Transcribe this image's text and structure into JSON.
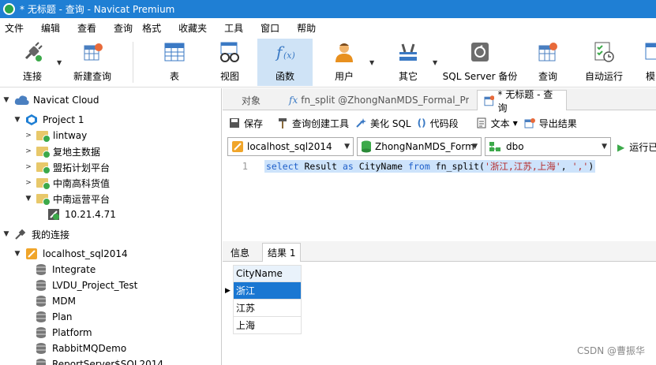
{
  "window": {
    "title": "* 无标题 - 查询 - Navicat Premium"
  },
  "menu": [
    "文件",
    "编辑",
    "查看",
    "查询",
    "格式",
    "收藏夹",
    "工具",
    "窗口",
    "帮助"
  ],
  "toolbar": {
    "buttons": [
      {
        "label": "连接",
        "icon": "plug-icon"
      },
      {
        "label": "新建查询",
        "icon": "new-query-icon"
      },
      {
        "label": "表",
        "icon": "table-icon"
      },
      {
        "label": "视图",
        "icon": "view-icon"
      },
      {
        "label": "函数",
        "icon": "function-icon"
      },
      {
        "label": "用户",
        "icon": "user-icon"
      },
      {
        "label": "其它",
        "icon": "tools-icon"
      },
      {
        "label": "SQL Server 备份",
        "icon": "backup-icon"
      },
      {
        "label": "查询",
        "icon": "query-icon"
      },
      {
        "label": "自动运行",
        "icon": "automation-icon"
      },
      {
        "label": "模",
        "icon": "model-icon"
      }
    ],
    "active": "函数"
  },
  "sidebar": {
    "items": [
      {
        "label": "Navicat Cloud",
        "level": 0,
        "icon": "cloud-icon",
        "expanded": true
      },
      {
        "label": "Project 1",
        "level": 1,
        "icon": "project-icon",
        "expanded": true
      },
      {
        "label": "lintway",
        "level": 2,
        "icon": "folder-icon",
        "expanded": false
      },
      {
        "label": "复地主数据",
        "level": 2,
        "icon": "folder-icon",
        "expanded": false
      },
      {
        "label": "盟拓计划平台",
        "level": 2,
        "icon": "folder-icon",
        "expanded": false
      },
      {
        "label": "中南高科货值",
        "level": 2,
        "icon": "folder-icon",
        "expanded": false
      },
      {
        "label": "中南运营平台",
        "level": 2,
        "icon": "folder-icon",
        "expanded": true
      },
      {
        "label": "10.21.4.71",
        "level": 3,
        "icon": "connection-icon",
        "expanded": false
      },
      {
        "label": "我的连接",
        "level": 0,
        "icon": "my-connections-icon",
        "expanded": true
      },
      {
        "label": "localhost_sql2014",
        "level": 1,
        "icon": "server-icon",
        "expanded": true
      },
      {
        "label": "Integrate",
        "level": 2,
        "icon": "database-icon"
      },
      {
        "label": "LVDU_Project_Test",
        "level": 2,
        "icon": "database-icon"
      },
      {
        "label": "MDM",
        "level": 2,
        "icon": "database-icon"
      },
      {
        "label": "Plan",
        "level": 2,
        "icon": "database-icon"
      },
      {
        "label": "Platform",
        "level": 2,
        "icon": "database-icon"
      },
      {
        "label": "RabbitMQDemo",
        "level": 2,
        "icon": "database-icon"
      },
      {
        "label": "ReportServer$SQL2014",
        "level": 2,
        "icon": "database-icon"
      }
    ]
  },
  "tabs": [
    {
      "label": "对象"
    },
    {
      "label": "fn_split @ZhongNanMDS_Formal_Pr..."
    },
    {
      "label": "* 无标题 - 查询"
    }
  ],
  "query_toolbar": {
    "save": "保存",
    "builder": "查询创建工具",
    "beautify": "美化 SQL",
    "snippet": "代码段",
    "text": "文本",
    "export": "导出结果"
  },
  "selectors": {
    "connection": "localhost_sql2014",
    "database": "ZhongNanMDS_Form",
    "schema": "dbo",
    "run": "运行已"
  },
  "editor": {
    "line_number": "1",
    "kw1": "select",
    "t1": " Result ",
    "kw2": "as",
    "t2": " CityName ",
    "kw3": "from",
    "t3": " fn_split(",
    "s1": "'浙江,江苏,上海'",
    "t4": ", ",
    "s2": "','",
    "t5": ")"
  },
  "results": {
    "tabs": [
      "信息",
      "结果 1"
    ],
    "active_tab": "结果 1",
    "columns": [
      "CityName"
    ],
    "rows": [
      "浙江",
      "江苏",
      "上海"
    ]
  },
  "watermark": "CSDN @曹振华",
  "colors": {
    "titlebar": "#1f7fd4",
    "selection": "#1a77d2",
    "keyword": "#1f5fc9",
    "string": "#b52a2a"
  }
}
